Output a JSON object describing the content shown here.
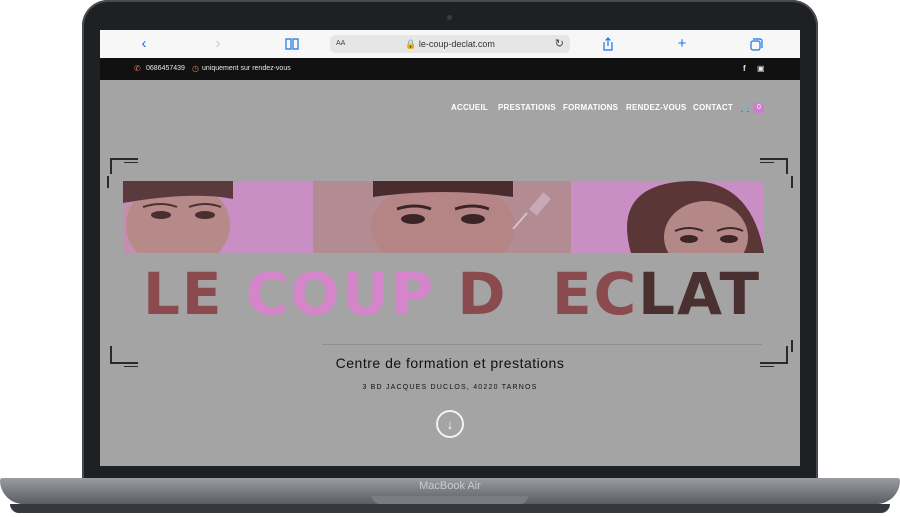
{
  "device": {
    "brand_label": "MacBook Air"
  },
  "browser": {
    "back_icon": "chevron-left-icon",
    "forward_icon": "chevron-right-icon",
    "bookmarks_icon": "book-icon",
    "text_size_label": "AA",
    "url": "le-coup-declat.com",
    "lock_icon": "lock-icon",
    "reload_icon": "reload-icon",
    "share_icon": "share-icon",
    "new_tab_icon": "plus-icon",
    "tabs_icon": "tabs-icon"
  },
  "site": {
    "topbar": {
      "phone": "0686457439",
      "note": "uniquement sur rendez-vous",
      "social": [
        "facebook-icon",
        "instagram-icon"
      ]
    },
    "nav": {
      "items": [
        {
          "label": "ACCUEIL"
        },
        {
          "label": "PRESTATIONS"
        },
        {
          "label": "FORMATIONS"
        },
        {
          "label": "RENDEZ-VOUS"
        },
        {
          "label": "CONTACT"
        }
      ],
      "cart_count": "0"
    },
    "hero": {
      "title_parts": [
        "LE ",
        "COUP",
        " D",
        "  EC",
        "LAT"
      ],
      "subtitle": "Centre de formation et prestations",
      "address": "3 BD JACQUES DUCLOS, 40220 TARNOS",
      "accent_color": "#d585c9",
      "overlay_color": "#a4a4a4"
    }
  }
}
